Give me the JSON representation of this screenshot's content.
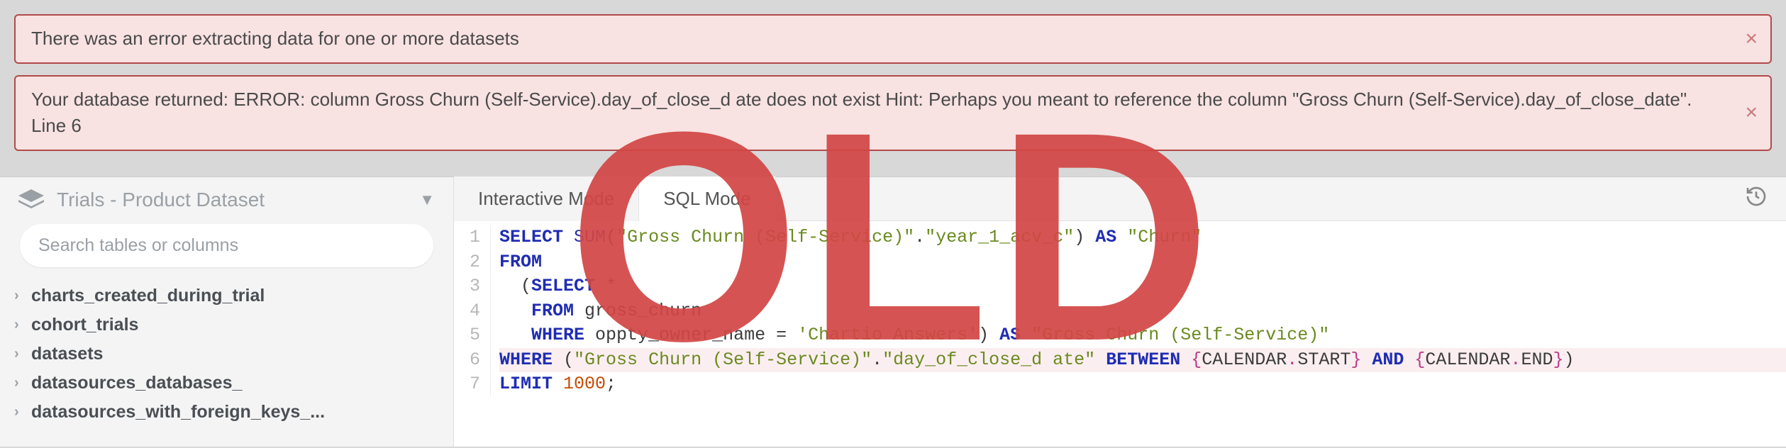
{
  "alerts": [
    {
      "text": "There was an error extracting data for one or more datasets"
    },
    {
      "text": "Your database returned: ERROR: column Gross Churn (Self-Service).day_of_close_d ate does not exist Hint: Perhaps you meant to reference the column \"Gross Churn (Self-Service).day_of_close_date\". Line 6"
    }
  ],
  "sidebar": {
    "dataset_label": "Trials - Product Dataset",
    "search_placeholder": "Search tables or columns",
    "tables": [
      "charts_created_during_trial",
      "cohort_trials",
      "datasets",
      "datasources_databases_",
      "datasources_with_foreign_keys_..."
    ]
  },
  "editor": {
    "tabs": {
      "interactive": "Interactive Mode",
      "sql": "SQL Mode",
      "active": "sql"
    },
    "line_numbers": [
      "1",
      "2",
      "3",
      "4",
      "5",
      "6",
      "7"
    ],
    "code_lines": [
      [
        {
          "t": "SELECT ",
          "c": "tok-kw"
        },
        {
          "t": "SUM",
          "c": "tok-func"
        },
        {
          "t": "(",
          "c": "tok-punct"
        },
        {
          "t": "\"Gross Churn (Self-Service)\"",
          "c": "tok-str"
        },
        {
          "t": ".",
          "c": "tok-punct"
        },
        {
          "t": "\"year_1_acv_c\"",
          "c": "tok-str"
        },
        {
          "t": ") ",
          "c": "tok-punct"
        },
        {
          "t": "AS ",
          "c": "tok-kw"
        },
        {
          "t": "\"Churn\"",
          "c": "tok-str"
        }
      ],
      [
        {
          "t": "FROM",
          "c": "tok-kw"
        }
      ],
      [
        {
          "t": "  (",
          "c": "tok-punct"
        },
        {
          "t": "SELECT ",
          "c": "tok-kw"
        },
        {
          "t": "*",
          "c": "tok-punct"
        }
      ],
      [
        {
          "t": "   ",
          "c": ""
        },
        {
          "t": "FROM ",
          "c": "tok-kw"
        },
        {
          "t": "gross_churn",
          "c": "tok-ident"
        }
      ],
      [
        {
          "t": "   ",
          "c": ""
        },
        {
          "t": "WHERE ",
          "c": "tok-kw"
        },
        {
          "t": "oppty_owner_name ",
          "c": "tok-ident"
        },
        {
          "t": "= ",
          "c": "tok-punct"
        },
        {
          "t": "'Chartio Answers'",
          "c": "tok-str"
        },
        {
          "t": ") ",
          "c": "tok-punct"
        },
        {
          "t": "AS ",
          "c": "tok-kw"
        },
        {
          "t": "\"Gross Churn (Self-Service)\"",
          "c": "tok-str"
        }
      ],
      [
        {
          "t": "WHERE ",
          "c": "tok-kw"
        },
        {
          "t": "(",
          "c": "tok-punct"
        },
        {
          "t": "\"Gross Churn (Self-Service)\"",
          "c": "tok-str"
        },
        {
          "t": ".",
          "c": "tok-punct"
        },
        {
          "t": "\"day_of_close_d ate\"",
          "c": "tok-str"
        },
        {
          "t": " ",
          "c": ""
        },
        {
          "t": "BETWEEN ",
          "c": "tok-kw"
        },
        {
          "t": "{",
          "c": "tok-brace"
        },
        {
          "t": "CALENDAR",
          "c": "tok-ident"
        },
        {
          "t": ".",
          "c": "tok-dot"
        },
        {
          "t": "START",
          "c": "tok-ident"
        },
        {
          "t": "}",
          "c": "tok-brace"
        },
        {
          "t": " ",
          "c": ""
        },
        {
          "t": "AND ",
          "c": "tok-kw"
        },
        {
          "t": "{",
          "c": "tok-brace"
        },
        {
          "t": "CALENDAR",
          "c": "tok-ident"
        },
        {
          "t": ".",
          "c": "tok-dot"
        },
        {
          "t": "END",
          "c": "tok-ident"
        },
        {
          "t": "}",
          "c": "tok-brace"
        },
        {
          "t": ")",
          "c": "tok-punct"
        }
      ],
      [
        {
          "t": "LIMIT ",
          "c": "tok-kw"
        },
        {
          "t": "1000",
          "c": "tok-num"
        },
        {
          "t": ";",
          "c": "tok-punct"
        }
      ]
    ],
    "error_line_index": 5
  },
  "watermark": "OLD"
}
